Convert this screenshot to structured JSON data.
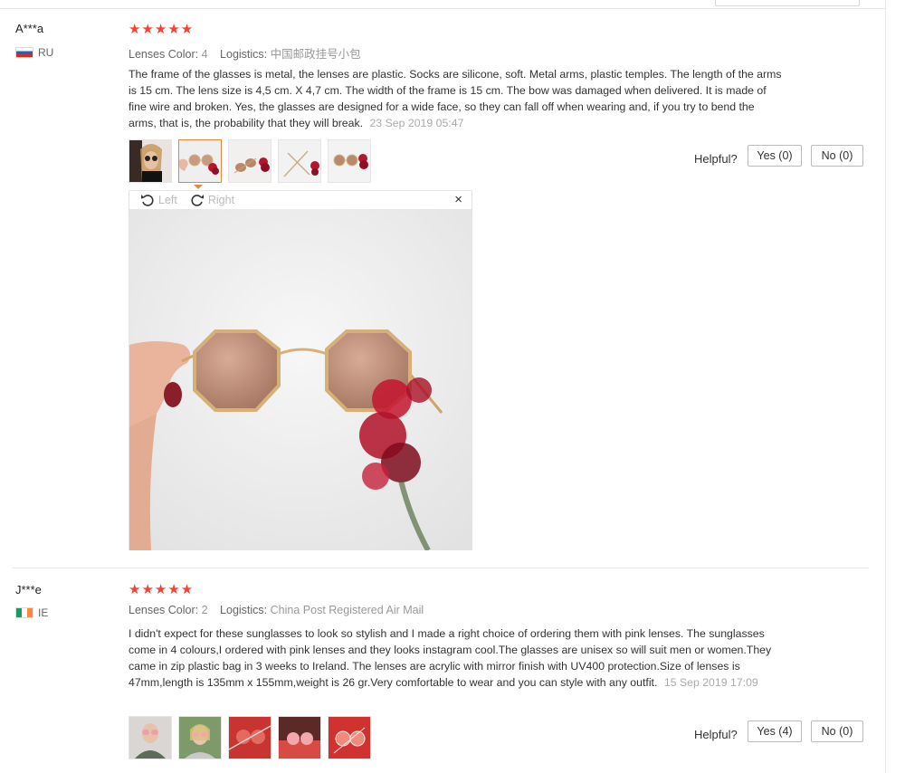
{
  "reviews": [
    {
      "user": "A***a",
      "country": "RU",
      "stars": "★★★★★",
      "lens_label": "Lenses Color:",
      "lens_value": "4",
      "logistics_label": "Logistics:",
      "logistics_value": "中国邮政挂号小包",
      "text": "The frame of the glasses is metal, the lenses are plastic. Socks are silicone, soft. Metal arms, plastic temples. The length of the arms is 15 cm. The lens size is 4,5 cm. X 4,7 cm. The width of the frame is 15 cm. The bow was damaged when delivered. It is made of fine wire and broken. Yes, the glasses are designed for a wide face, so they can fall off when wearing and, if you try to bend the arms, that is, the probability that they will break.",
      "date": "23 Sep 2019 05:47",
      "helpful_label": "Helpful?",
      "yes_label": "Yes (0)",
      "no_label": "No (0)",
      "viewer": {
        "left_label": "Left",
        "right_label": "Right",
        "close": "×"
      }
    },
    {
      "user": "J***e",
      "country": "IE",
      "stars": "★★★★★",
      "lens_label": "Lenses Color:",
      "lens_value": "2",
      "logistics_label": "Logistics:",
      "logistics_value": "China Post Registered Air Mail",
      "text": "I didn't expect for these sunglasses to look so stylish and I made a right choice of ordering them with pink lenses. The sunglasses come in 4 colours,I ordered with pink lenses and they looks instagram cool.The glasses are unisex so will suit men or women.They came in zip plastic bag in 3 weeks to Ireland. The lenses are acrylic with mirror finish  with UV400 protection.Size of lenses is 47mm,length is 135mm x 155mm,weight is 26 gr.Very  comfortable to wear and you can style with any outfit.",
      "date": "15 Sep 2019 17:09",
      "helpful_label": "Helpful?",
      "yes_label": "Yes (4)",
      "no_label": "No (0)"
    }
  ],
  "colors": {
    "star": "#f44336",
    "active_thumb": "#e08a3c"
  }
}
